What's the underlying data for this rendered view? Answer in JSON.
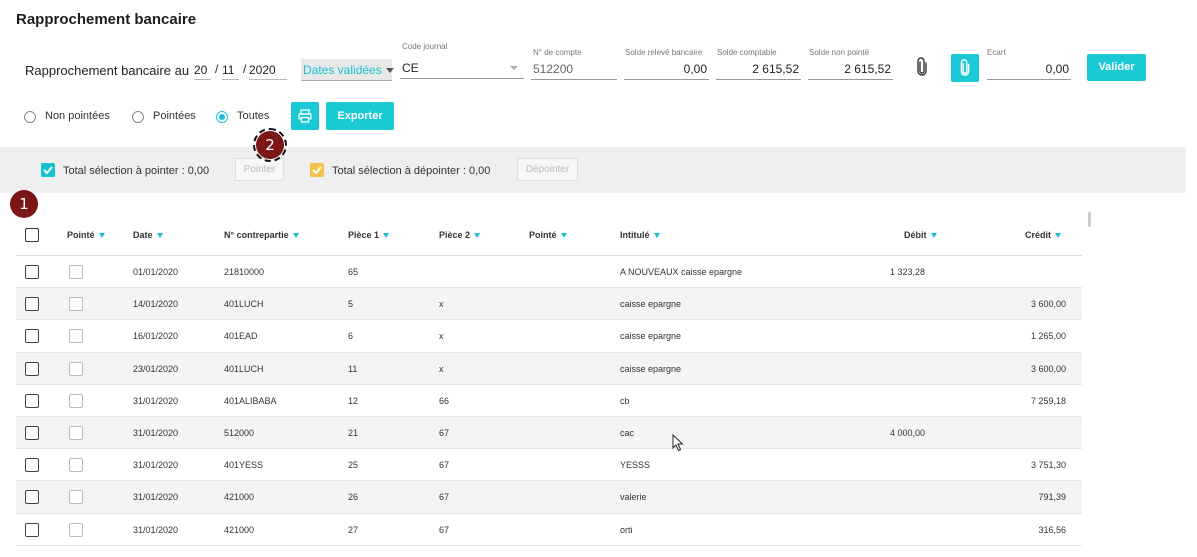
{
  "page": {
    "title": "Rapprochement bancaire"
  },
  "header": {
    "label": "Rapprochement bancaire au",
    "day": "20",
    "month": "11",
    "year": "2020",
    "slash1": "/",
    "slash2": "/",
    "date_mode": "Dates validées",
    "journal_label": "Code journal",
    "journal_value": "CE",
    "account_label": "N° de compte",
    "account_value": "512200",
    "releve_label": "Solde relevé bancaire",
    "releve_value": "0,00",
    "comptable_label": "Solde comptable",
    "comptable_value": "2 615,52",
    "non_pointe_label": "Solde non pointé",
    "non_pointe_value": "2 615,52",
    "ecart_label": "Ecart",
    "ecart_value": "0,00",
    "validate_label": "Valider"
  },
  "filters": {
    "options": [
      "Non pointées",
      "Pointées",
      "Toutes"
    ],
    "selected": "Toutes",
    "export_label": "Exporter"
  },
  "selection": {
    "to_point_label": "Total sélection à pointer : 0,00",
    "point_button": "Pointer",
    "to_unpoint_label": "Total sélection à dépointer : 0,00",
    "unpoint_button": "Dépointer"
  },
  "markers": [
    "1",
    "2"
  ],
  "colors": {
    "accent": "#19c9d4",
    "unpoint_check": "#f2c24b",
    "marker": "#7d1616"
  },
  "table": {
    "headers": [
      "Pointé",
      "Date",
      "N° contrepartie",
      "Pièce 1",
      "Pièce 2",
      "Pointé",
      "Intitulé",
      "Débit",
      "Crédit"
    ],
    "rows": [
      {
        "date": "01/01/2020",
        "contre": "21810000",
        "p1": "65",
        "p2": "",
        "pointe": "",
        "intitule": "A NOUVEAUX caisse epargne",
        "debit": "1 323,28",
        "credit": ""
      },
      {
        "date": "14/01/2020",
        "contre": "401LUCH",
        "p1": "5",
        "p2": "x",
        "pointe": "",
        "intitule": "caisse epargne",
        "debit": "",
        "credit": "3 600,00"
      },
      {
        "date": "16/01/2020",
        "contre": "401EAD",
        "p1": "6",
        "p2": "x",
        "pointe": "",
        "intitule": "caisse epargne",
        "debit": "",
        "credit": "1 265,00"
      },
      {
        "date": "23/01/2020",
        "contre": "401LUCH",
        "p1": "11",
        "p2": "x",
        "pointe": "",
        "intitule": "caisse epargne",
        "debit": "",
        "credit": "3 600,00"
      },
      {
        "date": "31/01/2020",
        "contre": "401ALIBABA",
        "p1": "12",
        "p2": "66",
        "pointe": "",
        "intitule": "cb",
        "debit": "",
        "credit": "7 259,18"
      },
      {
        "date": "31/01/2020",
        "contre": "512000",
        "p1": "21",
        "p2": "67",
        "pointe": "",
        "intitule": "cac",
        "debit": "4 000,00",
        "credit": ""
      },
      {
        "date": "31/01/2020",
        "contre": "401YESS",
        "p1": "25",
        "p2": "67",
        "pointe": "",
        "intitule": "YESSS",
        "debit": "",
        "credit": "3 751,30"
      },
      {
        "date": "31/01/2020",
        "contre": "421000",
        "p1": "26",
        "p2": "67",
        "pointe": "",
        "intitule": "valerie",
        "debit": "",
        "credit": "791,39"
      },
      {
        "date": "31/01/2020",
        "contre": "421000",
        "p1": "27",
        "p2": "67",
        "pointe": "",
        "intitule": "orti",
        "debit": "",
        "credit": "316,56"
      }
    ]
  }
}
